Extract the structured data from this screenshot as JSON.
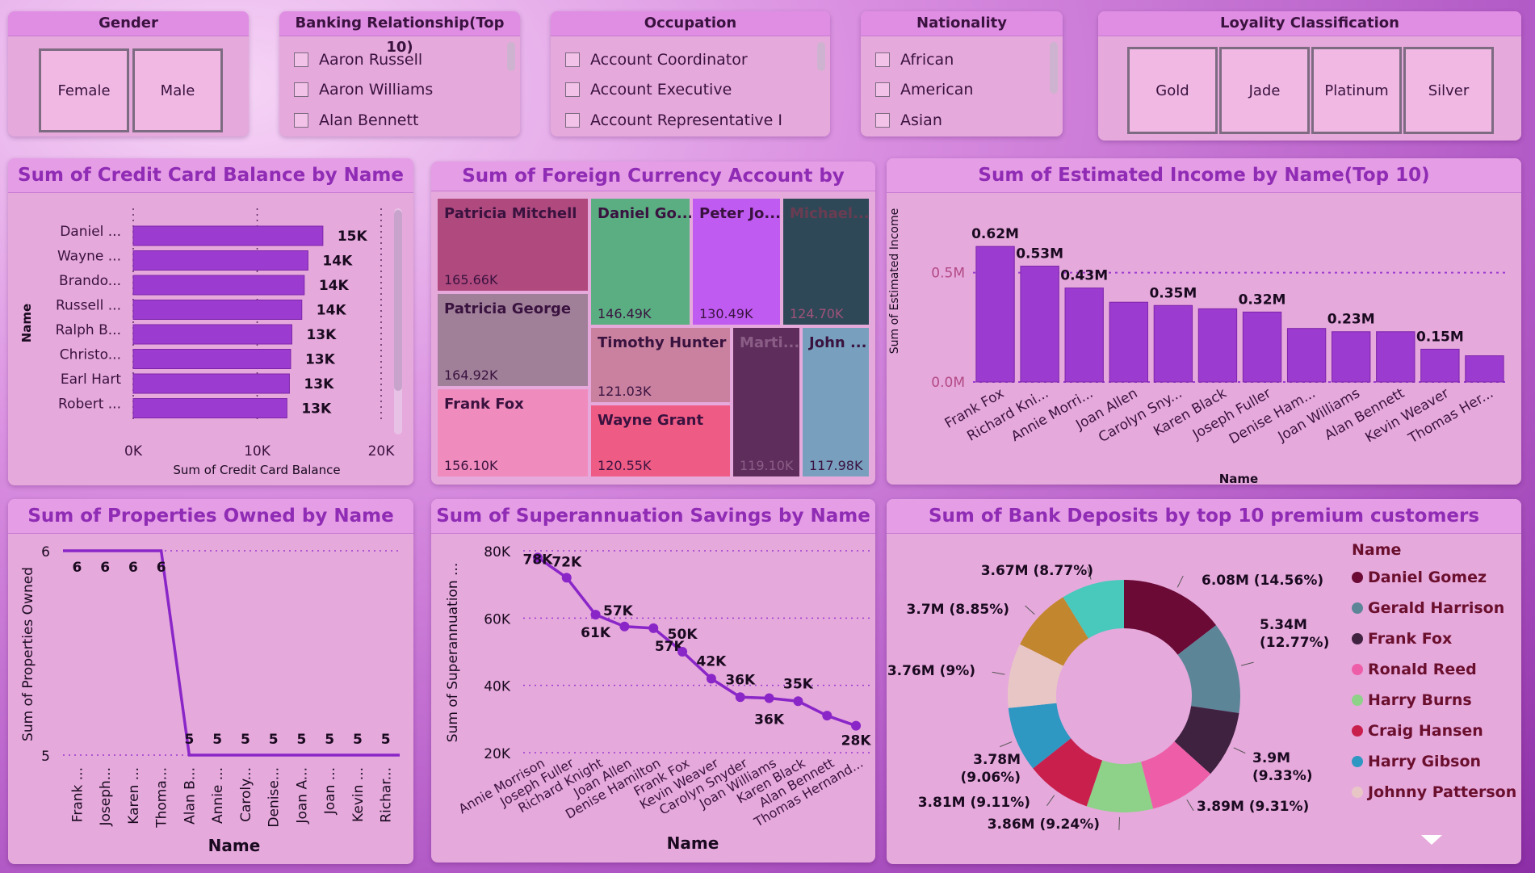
{
  "slicers": {
    "gender": {
      "title": "Gender",
      "options": [
        "Female",
        "Male"
      ]
    },
    "banking": {
      "title": "Banking Relationship(Top 10)",
      "options": [
        "Aaron Russell",
        "Aaron Williams",
        "Alan Bennett"
      ]
    },
    "occupation": {
      "title": "Occupation",
      "options": [
        "Account Coordinator",
        "Account Executive",
        "Account Representative I"
      ]
    },
    "nationality": {
      "title": "Nationality",
      "options": [
        "African",
        "American",
        "Asian"
      ]
    },
    "loyalty": {
      "title": "Loyality Classification",
      "options": [
        "Gold",
        "Jade",
        "Platinum",
        "Silver"
      ]
    }
  },
  "colors": {
    "bar": "#9b3bcf",
    "line": "#8a26c8",
    "title": "#8f2bb4"
  },
  "chart_data": [
    {
      "id": "credit",
      "type": "bar",
      "orientation": "horizontal",
      "title": "Sum of Credit Card Balance by Name",
      "xlabel": "Sum of Credit Card Balance",
      "ylabel": "Name",
      "xlim": [
        0,
        20000
      ],
      "xticks": [
        "0K",
        "10K",
        "20K"
      ],
      "categories": [
        "Daniel ...",
        "Wayne ...",
        "Brando...",
        "Russell ...",
        "Ralph B...",
        "Christo...",
        "Earl Hart",
        "Robert ..."
      ],
      "values": [
        15300,
        14100,
        13800,
        13600,
        12800,
        12700,
        12600,
        12400
      ],
      "labels": [
        "15K",
        "14K",
        "14K",
        "14K",
        "13K",
        "13K",
        "13K",
        "13K"
      ]
    },
    {
      "id": "treemap",
      "type": "treemap",
      "title": "Sum of Foreign Currency Account by Name",
      "items": [
        {
          "name": "Patricia Mitchell",
          "label": "165.66K",
          "value": 165.66,
          "color": "#b04a7e"
        },
        {
          "name": "Patricia George",
          "label": "164.92K",
          "value": 164.92,
          "color": "#a08099"
        },
        {
          "name": "Frank Fox",
          "label": "156.10K",
          "value": 156.1,
          "color": "#f08cbd"
        },
        {
          "name": "Daniel Go...",
          "label": "146.49K",
          "value": 146.49,
          "color": "#5aae82"
        },
        {
          "name": "Peter Jo...",
          "label": "130.49K",
          "value": 130.49,
          "color": "#c05bf2"
        },
        {
          "name": "Michael...",
          "label": "124.70K",
          "value": 124.7,
          "color": "#2f4857"
        },
        {
          "name": "Timothy Hunter",
          "label": "121.03K",
          "value": 121.03,
          "color": "#c9819f"
        },
        {
          "name": "Wayne Grant",
          "label": "120.55K",
          "value": 120.55,
          "color": "#ee5b85"
        },
        {
          "name": "Marti...",
          "label": "119.10K",
          "value": 119.1,
          "color": "#5f2d5c"
        },
        {
          "name": "John ...",
          "label": "117.98K",
          "value": 117.98,
          "color": "#78a0be"
        }
      ]
    },
    {
      "id": "income",
      "type": "bar",
      "title": "Sum of Estimated Income by Name(Top 10)",
      "xlabel": "Name",
      "ylabel": "Sum of Estimated Income",
      "ylim": [
        0,
        0.75
      ],
      "yticks": [
        "0.0M",
        "0.5M"
      ],
      "categories": [
        "Frank Fox",
        "Richard Kni...",
        "Annie Morri...",
        "Joan Allen",
        "Carolyn Sny...",
        "Karen Black",
        "Joseph Fuller",
        "Denise Ham...",
        "Joan Williams",
        "Alan Bennett",
        "Kevin Weaver",
        "Thomas Her..."
      ],
      "values": [
        0.62,
        0.53,
        0.43,
        0.365,
        0.35,
        0.335,
        0.32,
        0.245,
        0.23,
        0.23,
        0.15,
        0.12
      ],
      "labels": [
        "0.62M",
        "0.53M",
        "0.43M",
        "",
        "0.35M",
        "",
        "0.32M",
        "",
        "0.23M",
        "",
        "0.15M",
        ""
      ]
    },
    {
      "id": "properties",
      "type": "line",
      "title": "Sum of Properties Owned by Name",
      "xlabel": "Name",
      "ylabel": "Sum of Properties Owned",
      "ylim": [
        5,
        6
      ],
      "yticks": [
        "5",
        "6"
      ],
      "categories": [
        "Frank ...",
        "Joseph...",
        "Karen ...",
        "Thoma...",
        "Alan B...",
        "Annie ...",
        "Caroly...",
        "Denise...",
        "Joan A...",
        "Joan ...",
        "Kevin ...",
        "Richar..."
      ],
      "values": [
        6,
        6,
        6,
        6,
        5,
        5,
        5,
        5,
        5,
        5,
        5,
        5
      ],
      "labels": [
        "6",
        "6",
        "6",
        "6",
        "5",
        "5",
        "5",
        "5",
        "5",
        "5",
        "5",
        "5"
      ]
    },
    {
      "id": "super",
      "type": "line",
      "title": "Sum of Superannuation Savings by Name",
      "xlabel": "Name",
      "ylabel": "Sum of Superannuation ...",
      "ylim": [
        20000,
        80000
      ],
      "yticks": [
        "20K",
        "40K",
        "60K",
        "80K"
      ],
      "categories": [
        "Annie Morrison",
        "Joseph Fuller",
        "Richard Knight",
        "Joan Allen",
        "Denise Hamilton",
        "Frank Fox",
        "Kevin Weaver",
        "Carolyn Snyder",
        "Joan Williams",
        "Karen Black",
        "Alan Bennett",
        "Thomas Hernand..."
      ],
      "values": [
        78000,
        72000,
        61000,
        57500,
        57000,
        50000,
        42000,
        36500,
        36200,
        35300,
        31000,
        28000
      ],
      "labels": [
        "78K",
        "72K",
        "61K",
        "57K",
        "57K",
        "50K",
        "42K",
        "36K",
        "36K",
        "35K",
        "",
        "28K"
      ]
    },
    {
      "id": "deposits",
      "type": "pie",
      "donut": true,
      "title": "Sum of Bank Deposits by top 10 premium customers",
      "legend_title": "Name",
      "categories": [
        "Daniel Gomez",
        "Gerald Harrison",
        "Frank Fox",
        "Ronald Reed",
        "Harry Burns",
        "Craig Hansen",
        "Harry Gibson",
        "Johnny Patterson",
        "",
        ""
      ],
      "values": [
        6.08,
        5.34,
        3.9,
        3.89,
        3.86,
        3.81,
        3.78,
        3.76,
        3.7,
        3.67
      ],
      "labels": [
        "6.08M (14.56%)",
        "5.34M (12.77%)",
        "3.9M (9.33%)",
        "3.89M (9.31%)",
        "3.86M (9.24%)",
        "3.81M (9.11%)",
        "3.78M (9.06%)",
        "3.76M (9%)",
        "3.7M (8.85%)",
        "3.67M (8.77%)"
      ],
      "colors": [
        "#6a0a35",
        "#5c8598",
        "#3f2140",
        "#ee5ea8",
        "#8ed188",
        "#c81f4c",
        "#2e98c2",
        "#e8c6c6",
        "#c2862e",
        "#48c9bc"
      ]
    }
  ]
}
